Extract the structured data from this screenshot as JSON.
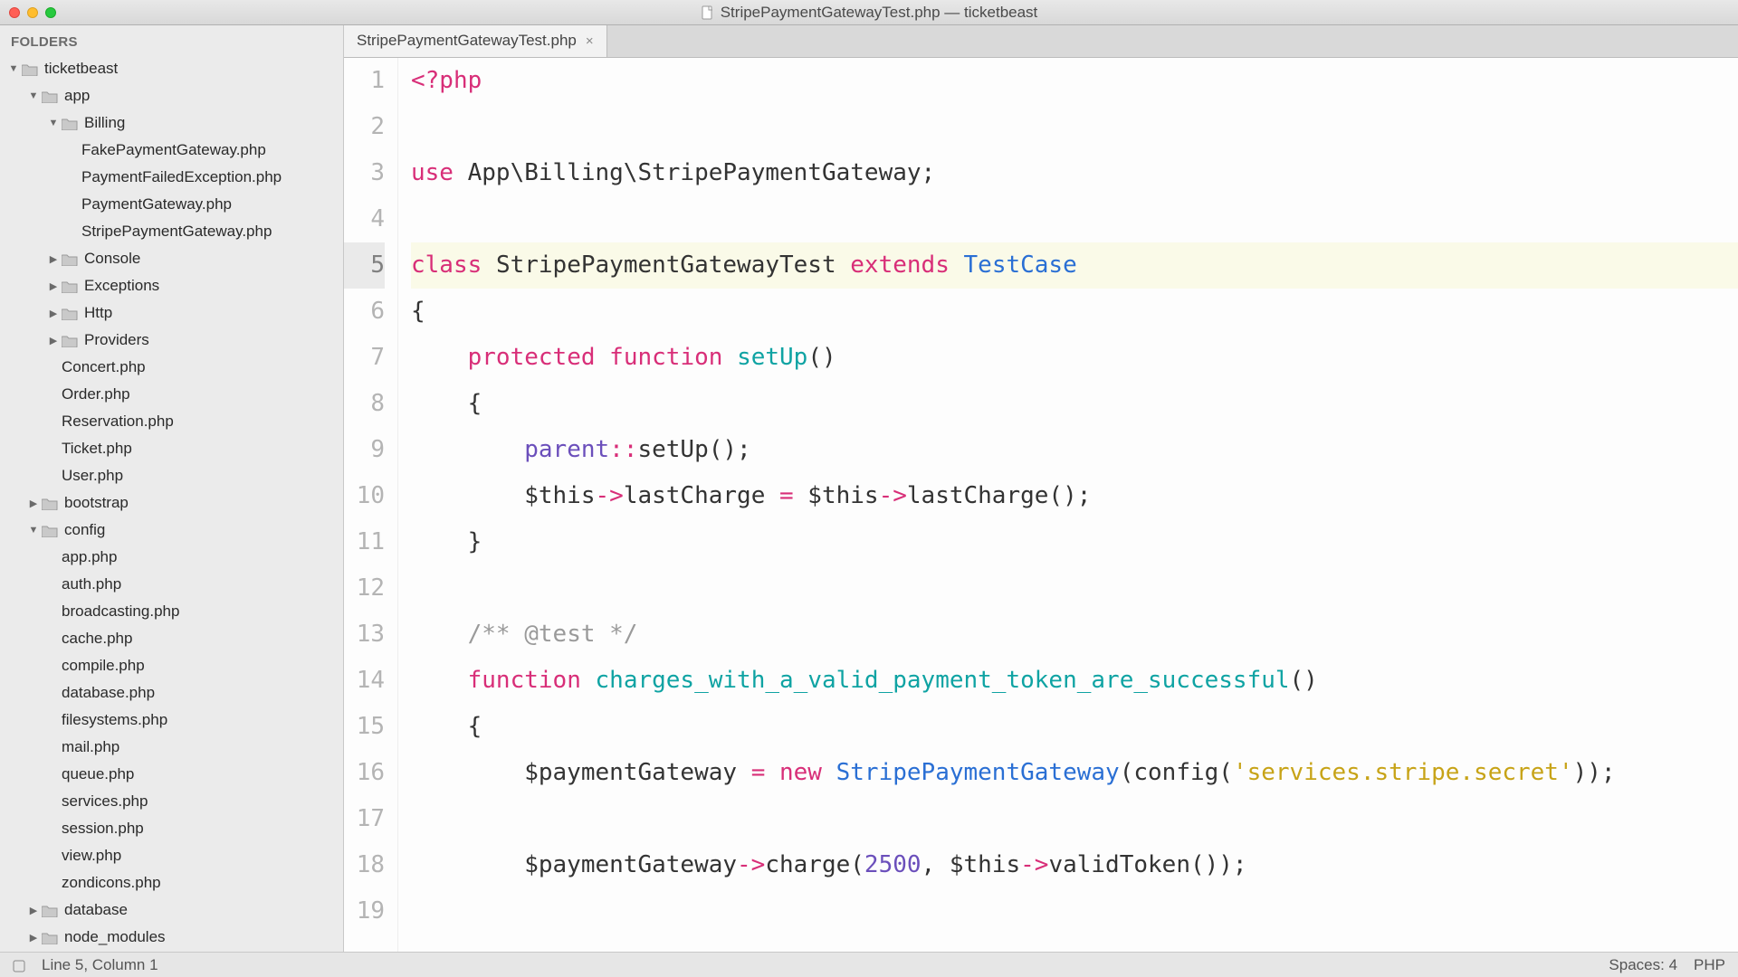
{
  "window": {
    "title": "StripePaymentGatewayTest.php — ticketbeast"
  },
  "sidebar": {
    "header": "FOLDERS",
    "tree": [
      {
        "depth": 0,
        "kind": "folder",
        "expanded": true,
        "label": "ticketbeast"
      },
      {
        "depth": 1,
        "kind": "folder",
        "expanded": true,
        "label": "app"
      },
      {
        "depth": 2,
        "kind": "folder",
        "expanded": true,
        "label": "Billing"
      },
      {
        "depth": 3,
        "kind": "file",
        "label": "FakePaymentGateway.php"
      },
      {
        "depth": 3,
        "kind": "file",
        "label": "PaymentFailedException.php"
      },
      {
        "depth": 3,
        "kind": "file",
        "label": "PaymentGateway.php"
      },
      {
        "depth": 3,
        "kind": "file",
        "label": "StripePaymentGateway.php"
      },
      {
        "depth": 2,
        "kind": "folder",
        "expanded": false,
        "label": "Console"
      },
      {
        "depth": 2,
        "kind": "folder",
        "expanded": false,
        "label": "Exceptions"
      },
      {
        "depth": 2,
        "kind": "folder",
        "expanded": false,
        "label": "Http"
      },
      {
        "depth": 2,
        "kind": "folder",
        "expanded": false,
        "label": "Providers"
      },
      {
        "depth": 2,
        "kind": "file",
        "label": "Concert.php"
      },
      {
        "depth": 2,
        "kind": "file",
        "label": "Order.php"
      },
      {
        "depth": 2,
        "kind": "file",
        "label": "Reservation.php"
      },
      {
        "depth": 2,
        "kind": "file",
        "label": "Ticket.php"
      },
      {
        "depth": 2,
        "kind": "file",
        "label": "User.php"
      },
      {
        "depth": 1,
        "kind": "folder",
        "expanded": false,
        "label": "bootstrap"
      },
      {
        "depth": 1,
        "kind": "folder",
        "expanded": true,
        "label": "config"
      },
      {
        "depth": 2,
        "kind": "file",
        "label": "app.php"
      },
      {
        "depth": 2,
        "kind": "file",
        "label": "auth.php"
      },
      {
        "depth": 2,
        "kind": "file",
        "label": "broadcasting.php"
      },
      {
        "depth": 2,
        "kind": "file",
        "label": "cache.php"
      },
      {
        "depth": 2,
        "kind": "file",
        "label": "compile.php"
      },
      {
        "depth": 2,
        "kind": "file",
        "label": "database.php"
      },
      {
        "depth": 2,
        "kind": "file",
        "label": "filesystems.php"
      },
      {
        "depth": 2,
        "kind": "file",
        "label": "mail.php"
      },
      {
        "depth": 2,
        "kind": "file",
        "label": "queue.php"
      },
      {
        "depth": 2,
        "kind": "file",
        "label": "services.php"
      },
      {
        "depth": 2,
        "kind": "file",
        "label": "session.php"
      },
      {
        "depth": 2,
        "kind": "file",
        "label": "view.php"
      },
      {
        "depth": 2,
        "kind": "file",
        "label": "zondicons.php"
      },
      {
        "depth": 1,
        "kind": "folder",
        "expanded": false,
        "label": "database"
      },
      {
        "depth": 1,
        "kind": "folder",
        "expanded": false,
        "label": "node_modules"
      }
    ]
  },
  "tabs": [
    {
      "label": "StripePaymentGatewayTest.php",
      "active": true
    }
  ],
  "code": {
    "active_line": 5,
    "lines": [
      {
        "n": 1,
        "tokens": [
          {
            "t": "<?php",
            "c": "k-pink"
          }
        ]
      },
      {
        "n": 2,
        "tokens": [
          {
            "t": " ",
            "c": ""
          }
        ]
      },
      {
        "n": 3,
        "tokens": [
          {
            "t": "use",
            "c": "k-pink"
          },
          {
            "t": " App\\Billing\\StripePaymentGateway;",
            "c": ""
          }
        ]
      },
      {
        "n": 4,
        "tokens": [
          {
            "t": " ",
            "c": ""
          }
        ]
      },
      {
        "n": 5,
        "tokens": [
          {
            "t": "class",
            "c": "k-pink"
          },
          {
            "t": " ",
            "c": ""
          },
          {
            "t": "StripePaymentGatewayTest",
            "c": ""
          },
          {
            "t": " ",
            "c": ""
          },
          {
            "t": "extends",
            "c": "k-pink"
          },
          {
            "t": " ",
            "c": ""
          },
          {
            "t": "TestCase",
            "c": "k-blue"
          }
        ]
      },
      {
        "n": 6,
        "tokens": [
          {
            "t": "{",
            "c": ""
          }
        ]
      },
      {
        "n": 7,
        "tokens": [
          {
            "t": "    ",
            "c": ""
          },
          {
            "t": "protected",
            "c": "k-pink"
          },
          {
            "t": " ",
            "c": ""
          },
          {
            "t": "function",
            "c": "k-pink"
          },
          {
            "t": " ",
            "c": ""
          },
          {
            "t": "setUp",
            "c": "k-teal"
          },
          {
            "t": "()",
            "c": ""
          }
        ]
      },
      {
        "n": 8,
        "tokens": [
          {
            "t": "    {",
            "c": ""
          }
        ]
      },
      {
        "n": 9,
        "tokens": [
          {
            "t": "        ",
            "c": ""
          },
          {
            "t": "parent",
            "c": "k-const"
          },
          {
            "t": "::",
            "c": "k-pink"
          },
          {
            "t": "setUp();",
            "c": ""
          }
        ]
      },
      {
        "n": 10,
        "tokens": [
          {
            "t": "        $this",
            "c": ""
          },
          {
            "t": "->",
            "c": "k-pink"
          },
          {
            "t": "lastCharge ",
            "c": ""
          },
          {
            "t": "=",
            "c": "k-pink"
          },
          {
            "t": " $this",
            "c": ""
          },
          {
            "t": "->",
            "c": "k-pink"
          },
          {
            "t": "lastCharge();",
            "c": ""
          }
        ]
      },
      {
        "n": 11,
        "tokens": [
          {
            "t": "    }",
            "c": ""
          }
        ]
      },
      {
        "n": 12,
        "tokens": [
          {
            "t": " ",
            "c": ""
          }
        ]
      },
      {
        "n": 13,
        "tokens": [
          {
            "t": "    ",
            "c": ""
          },
          {
            "t": "/** @test */",
            "c": "k-grey"
          }
        ]
      },
      {
        "n": 14,
        "tokens": [
          {
            "t": "    ",
            "c": ""
          },
          {
            "t": "function",
            "c": "k-pink"
          },
          {
            "t": " ",
            "c": ""
          },
          {
            "t": "charges_with_a_valid_payment_token_are_successful",
            "c": "k-teal"
          },
          {
            "t": "()",
            "c": ""
          }
        ]
      },
      {
        "n": 15,
        "tokens": [
          {
            "t": "    {",
            "c": ""
          }
        ]
      },
      {
        "n": 16,
        "tokens": [
          {
            "t": "        $paymentGateway ",
            "c": ""
          },
          {
            "t": "=",
            "c": "k-pink"
          },
          {
            "t": " ",
            "c": ""
          },
          {
            "t": "new",
            "c": "k-pink"
          },
          {
            "t": " ",
            "c": ""
          },
          {
            "t": "StripePaymentGateway",
            "c": "k-blue"
          },
          {
            "t": "(config(",
            "c": ""
          },
          {
            "t": "'services.stripe.secret'",
            "c": "k-str"
          },
          {
            "t": "));",
            "c": ""
          }
        ]
      },
      {
        "n": 17,
        "tokens": [
          {
            "t": " ",
            "c": ""
          }
        ]
      },
      {
        "n": 18,
        "tokens": [
          {
            "t": "        $paymentGateway",
            "c": ""
          },
          {
            "t": "->",
            "c": "k-pink"
          },
          {
            "t": "charge(",
            "c": ""
          },
          {
            "t": "2500",
            "c": "k-num"
          },
          {
            "t": ", $this",
            "c": ""
          },
          {
            "t": "->",
            "c": "k-pink"
          },
          {
            "t": "validToken());",
            "c": ""
          }
        ]
      },
      {
        "n": 19,
        "tokens": [
          {
            "t": " ",
            "c": ""
          }
        ]
      }
    ]
  },
  "statusbar": {
    "position": "Line 5, Column 1",
    "spaces": "Spaces: 4",
    "lang": "PHP"
  }
}
